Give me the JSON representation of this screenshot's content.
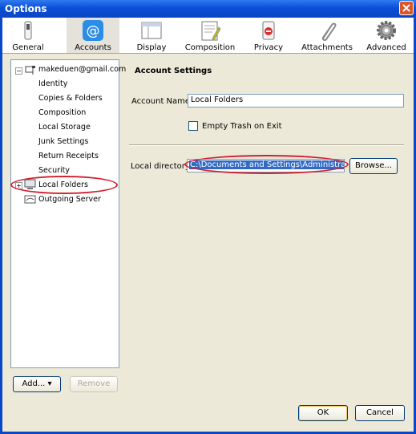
{
  "window": {
    "title": "Options"
  },
  "toolbar": {
    "items": [
      {
        "label": "General",
        "icon": "switch-icon"
      },
      {
        "label": "Accounts",
        "icon": "at-sign-icon",
        "selected": true
      },
      {
        "label": "Display",
        "icon": "window-icon"
      },
      {
        "label": "Composition",
        "icon": "composition-icon"
      },
      {
        "label": "Privacy",
        "icon": "privacy-icon"
      },
      {
        "label": "Attachments",
        "icon": "paperclip-icon"
      },
      {
        "label": "Advanced",
        "icon": "gear-icon"
      }
    ]
  },
  "tree": {
    "account": "makeduen@gmail.com",
    "children": [
      "Identity",
      "Copies & Folders",
      "Composition",
      "Local Storage",
      "Junk Settings",
      "Return Receipts",
      "Security"
    ],
    "local_folders": "Local Folders",
    "outgoing": "Outgoing Server"
  },
  "tree_buttons": {
    "add": "Add...",
    "remove": "Remove"
  },
  "panel": {
    "heading": "Account Settings",
    "account_name_label": "Account Name:",
    "account_name_value": "Local Folders",
    "empty_trash_label": "Empty Trash on Exit",
    "empty_trash_checked": false,
    "local_dir_label": "Local directory:",
    "local_dir_value": "C:\\Documents and Settings\\Administrator\\Al",
    "browse_label": "Browse..."
  },
  "footer": {
    "ok": "OK",
    "cancel": "Cancel"
  },
  "colors": {
    "accent": "#0a4fd6",
    "annotation": "#d2202f",
    "selection": "#316ac5"
  }
}
